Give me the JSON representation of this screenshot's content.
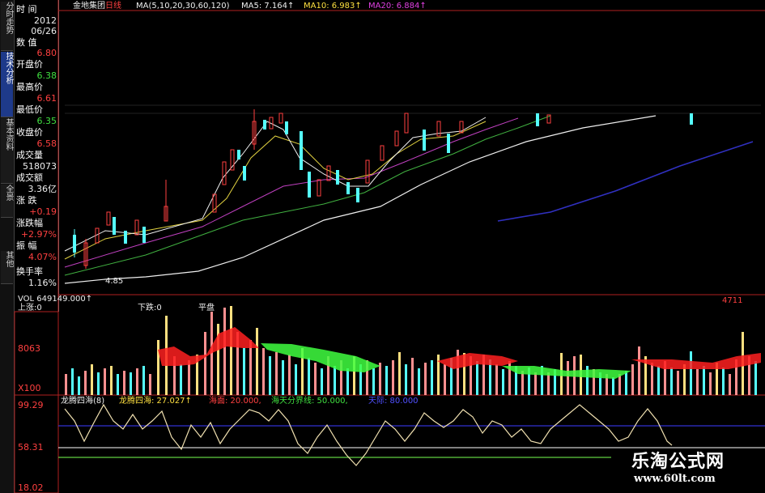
{
  "tabs": [
    "分时走势",
    "技术分析",
    "基本资料",
    "全景",
    "其他"
  ],
  "active_tab": 1,
  "info": [
    {
      "label": "时  间",
      "value": "2012",
      "value2": "06/26",
      "color": "white"
    },
    {
      "label": "数  值",
      "value": "6.80",
      "color": "red"
    },
    {
      "label": "开盘价",
      "value": "6.38",
      "color": "green"
    },
    {
      "label": "最高价",
      "value": "6.61",
      "color": "red"
    },
    {
      "label": "最低价",
      "value": "6.35",
      "color": "green"
    },
    {
      "label": "收盘价",
      "value": "6.58",
      "color": "red"
    },
    {
      "label": "成交量",
      "value": "518073",
      "color": "white"
    },
    {
      "label": "成交额",
      "value": "3.36亿",
      "color": "white"
    },
    {
      "label": "涨  跌",
      "value": "+0.19",
      "color": "red"
    },
    {
      "label": "涨跌幅",
      "value": "+2.97%",
      "color": "red"
    },
    {
      "label": "振  幅",
      "value": "4.07%",
      "color": "red"
    },
    {
      "label": "换手率",
      "value": "1.16%",
      "color": "white"
    }
  ],
  "header": {
    "stock": "金地集团",
    "period": "日线",
    "ma_params": "MA(5,10,20,30,60,120)",
    "ma5": "MA5: 7.164↑",
    "ma10": "MA10: 6.983↑",
    "ma20": "MA20: 6.884↑"
  },
  "price": {
    "low_label": "4.85"
  },
  "vol": {
    "title": "VOL 649149.000↑",
    "up": "上涨:0",
    "down": "下跌:0",
    "flat": "平盘",
    "right": "4711",
    "scale_mid": "8063",
    "scale_unit": "X100"
  },
  "ind": {
    "name": "龙腾四海(8)",
    "v1": "龙腾四海: 27.027↑",
    "v2": "海面: 20.000,",
    "v3": "海天分界线: 50.000,",
    "v4": "天际: 80.000",
    "scale": [
      "99.29",
      "58.31",
      "18.02"
    ]
  },
  "watermark": {
    "line1": "乐淘公式网",
    "line2": "www.60lt.com"
  },
  "colors": {
    "up": "#ff4040",
    "down": "#5ff",
    "bg": "#000"
  }
}
